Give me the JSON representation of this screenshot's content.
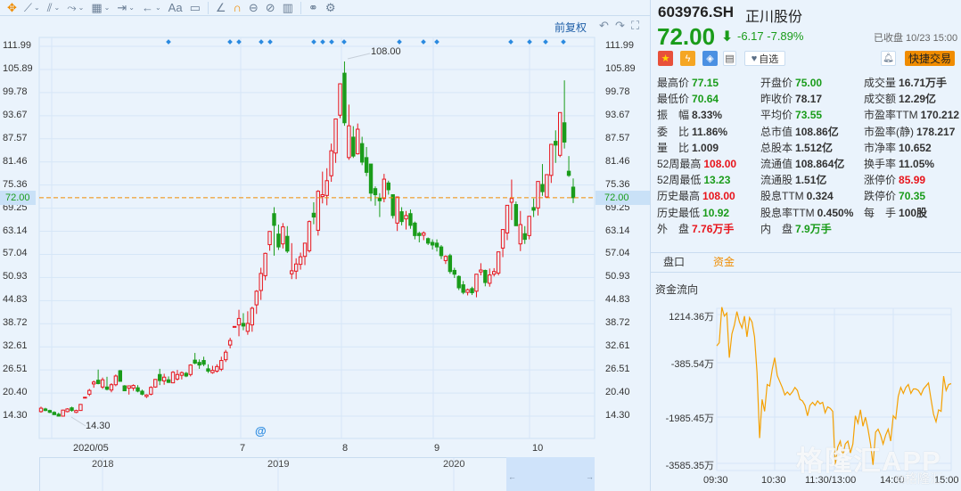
{
  "toolbar": {
    "items": [
      {
        "name": "move-tool-icon",
        "glyph": "✥",
        "chev": false,
        "accent": true
      },
      {
        "name": "line-tool-icon",
        "glyph": "⟋",
        "chev": true
      },
      {
        "name": "polyline-tool-icon",
        "glyph": "⫽",
        "chev": true
      },
      {
        "name": "wave-tool-icon",
        "glyph": "⤳",
        "chev": true
      },
      {
        "name": "shape-tool-icon",
        "glyph": "▦",
        "chev": true
      },
      {
        "name": "measure-tool-icon",
        "glyph": "⇥",
        "chev": true
      },
      {
        "name": "arrow-tool-icon",
        "glyph": "←",
        "chev": true
      },
      {
        "name": "text-tool-icon",
        "glyph": "Aa",
        "chev": false
      },
      {
        "name": "comment-tool-icon",
        "glyph": "▭",
        "chev": false
      },
      {
        "sep": true
      },
      {
        "name": "angle-tool-icon",
        "glyph": "∠",
        "chev": false
      },
      {
        "name": "magnet-icon",
        "glyph": "∩",
        "chev": false,
        "accent": true
      },
      {
        "name": "lock-drawing-icon",
        "glyph": "⊖",
        "chev": false
      },
      {
        "name": "hide-drawing-icon",
        "glyph": "⊘",
        "chev": false
      },
      {
        "name": "delete-icon",
        "glyph": "▥",
        "chev": false
      },
      {
        "sep": true
      },
      {
        "name": "compare-icon",
        "glyph": "⚭",
        "chev": false
      },
      {
        "name": "settings-icon",
        "glyph": "⚙",
        "chev": false
      }
    ]
  },
  "chart": {
    "adjust_label": "前复权",
    "undo": "↶",
    "redo": "↷",
    "fullscreen": "⛶",
    "current_price_tag": "72.00",
    "max_annotation": "108.00",
    "min_annotation": "14.30",
    "search_icon": "@",
    "x_labels": [
      "2020/05",
      "7",
      "8",
      "9",
      "10"
    ],
    "nav_years": [
      "2018",
      "2019",
      "2020"
    ],
    "nav_left": "←",
    "nav_right": "→"
  },
  "chart_data": {
    "type": "candlestick",
    "ylim": [
      14.3,
      111.99
    ],
    "y_ticks": [
      "111.99",
      "105.89",
      "99.78",
      "93.67",
      "87.57",
      "81.46",
      "75.36",
      "69.25",
      "63.14",
      "57.04",
      "50.93",
      "44.83",
      "38.72",
      "32.61",
      "26.51",
      "20.40",
      "14.30"
    ],
    "current_price": 72.0,
    "high_mark": 108.0,
    "low_mark": 14.3,
    "candles": [
      [
        15.5,
        16.8,
        15.2,
        16.4
      ],
      [
        16.2,
        16.5,
        15.6,
        15.8
      ],
      [
        15.8,
        16,
        15.1,
        15.3
      ],
      [
        15.3,
        15.6,
        14.6,
        14.7
      ],
      [
        14.8,
        15.2,
        14.2,
        14.3
      ],
      [
        14.3,
        16,
        14.2,
        15.9
      ],
      [
        15.5,
        16.4,
        15.3,
        16.2
      ],
      [
        16.5,
        16.8,
        15.5,
        15.8
      ],
      [
        15.3,
        16,
        15.1,
        15.8
      ],
      [
        15.8,
        17.5,
        15.7,
        17.4
      ],
      [
        19.3,
        19.3,
        19.3,
        19.3
      ],
      [
        20.1,
        21.5,
        19.6,
        21.1
      ],
      [
        22.8,
        23.7,
        21.8,
        23.3
      ],
      [
        23.8,
        26.6,
        22.7,
        22.9
      ],
      [
        22,
        24.5,
        21.5,
        23.9
      ],
      [
        22,
        24.7,
        21.1,
        21.4
      ],
      [
        21.2,
        23,
        20.6,
        22.6
      ],
      [
        22.6,
        25.3,
        22.2,
        24.9
      ],
      [
        26.3,
        26.5,
        23.4,
        23.5
      ],
      [
        22.3,
        22.5,
        21,
        21
      ],
      [
        21.7,
        22.3,
        20,
        22.3
      ],
      [
        21.7,
        22.7,
        21,
        22.4
      ],
      [
        21.8,
        22.5,
        20.6,
        20.9
      ],
      [
        20.9,
        21.3,
        19.8,
        20.1
      ],
      [
        19.5,
        20.1,
        19.1,
        19.9
      ],
      [
        20.1,
        22.2,
        19.8,
        21.9
      ],
      [
        22,
        24.1,
        21.8,
        24
      ],
      [
        25.3,
        26.8,
        22.5,
        23.7
      ],
      [
        23.6,
        25.5,
        22.6,
        24.6
      ],
      [
        23.9,
        24.8,
        23.1,
        23.2
      ],
      [
        23.1,
        26.2,
        23,
        25.9
      ],
      [
        24.1,
        26.5,
        23.7,
        25.3
      ],
      [
        25.1,
        26.1,
        24,
        25.8
      ],
      [
        25.6,
        26,
        24.6,
        24.9
      ],
      [
        25.3,
        28,
        24.8,
        27.8
      ],
      [
        29.1,
        31,
        28,
        28.3
      ],
      [
        28.5,
        29.3,
        26.8,
        27.8
      ],
      [
        29,
        30,
        27.5,
        28
      ],
      [
        26.8,
        28,
        25.7,
        26.2
      ],
      [
        25.8,
        27.6,
        25.5,
        26.4
      ],
      [
        26.2,
        28,
        25.8,
        27.4
      ],
      [
        26.7,
        30,
        26.2,
        29
      ],
      [
        29.2,
        31.8,
        28.6,
        31.2
      ],
      [
        33.1,
        35,
        32.2,
        34.3
      ],
      [
        38,
        38,
        38,
        38
      ],
      [
        38.4,
        42.4,
        35.4,
        40.1
      ],
      [
        38.8,
        41.5,
        37,
        38.1
      ],
      [
        36.7,
        42,
        35.8,
        38.8
      ],
      [
        38.4,
        43.2,
        36.6,
        42.8
      ],
      [
        43.7,
        47.6,
        41.3,
        47.3
      ],
      [
        47.5,
        53.5,
        45,
        52
      ],
      [
        51.4,
        57.5,
        50.2,
        57.3
      ],
      [
        59.6,
        63.1,
        58,
        63.1
      ],
      [
        67.8,
        69.5,
        56.7,
        64.7
      ],
      [
        62.4,
        64.9,
        58.2,
        59
      ],
      [
        59.8,
        65.3,
        58.6,
        64.3
      ],
      [
        61.8,
        64.5,
        57.4,
        57.9
      ],
      [
        51.9,
        60,
        50.5,
        52.7
      ],
      [
        52.6,
        56,
        50.5,
        54.5
      ],
      [
        54.4,
        57.5,
        53,
        56.4
      ],
      [
        56.5,
        60,
        54.2,
        60
      ],
      [
        58,
        66,
        57.5,
        65.7
      ],
      [
        67.9,
        70.8,
        65,
        66.9
      ],
      [
        63.4,
        74,
        62,
        73.7
      ],
      [
        72.3,
        78.9,
        70.5,
        72.8
      ],
      [
        72.6,
        79.8,
        70,
        76.5
      ],
      [
        77.8,
        86.3,
        76.2,
        84.4
      ],
      [
        83.8,
        92.8,
        81.2,
        92.8
      ],
      [
        93.8,
        102.1,
        93,
        102.1
      ],
      [
        104.9,
        108,
        91,
        91.8
      ],
      [
        82.6,
        96.6,
        82,
        91
      ],
      [
        88,
        90.9,
        82.5,
        83
      ],
      [
        83.6,
        91.6,
        83.4,
        90.1
      ],
      [
        86.3,
        88.1,
        80.6,
        81.4
      ],
      [
        82.6,
        85.4,
        77.7,
        78.7
      ],
      [
        80.9,
        80.9,
        71.1,
        73.2
      ],
      [
        74.4,
        75,
        69.9,
        72.8
      ],
      [
        71.9,
        73.2,
        66.9,
        71.2
      ],
      [
        71.8,
        78.3,
        70.8,
        76.9
      ],
      [
        75.9,
        76.5,
        72.8,
        74.1
      ],
      [
        72.8,
        72.8,
        66.5,
        67.3
      ],
      [
        65.3,
        72.2,
        63.2,
        72.2
      ],
      [
        68.3,
        69.5,
        64.7,
        65.7
      ],
      [
        66.4,
        68.5,
        63.6,
        67.3
      ],
      [
        67.8,
        68.9,
        63.8,
        64.7
      ],
      [
        65.3,
        65.7,
        61,
        62
      ],
      [
        62.6,
        63,
        60.2,
        62
      ],
      [
        62.1,
        63.1,
        60.8,
        62.7
      ],
      [
        61.2,
        61.5,
        59.5,
        60
      ],
      [
        60.2,
        61,
        58.3,
        59.5
      ],
      [
        60,
        61,
        57.8,
        59
      ],
      [
        59,
        59.5,
        55.8,
        56.7
      ],
      [
        55.4,
        56.8,
        54.5,
        56.5
      ],
      [
        56.7,
        57.2,
        51.9,
        52.5
      ],
      [
        52.8,
        53.5,
        50.8,
        51.8
      ],
      [
        51.2,
        51.5,
        47.6,
        48.2
      ],
      [
        49,
        50,
        46.5,
        47
      ],
      [
        47,
        48,
        46.2,
        47.7
      ],
      [
        48,
        48.5,
        46.3,
        46.9
      ],
      [
        47.3,
        51.8,
        45.7,
        51.8
      ],
      [
        52.4,
        54.7,
        51.5,
        52.9
      ],
      [
        52.8,
        53,
        48.6,
        49.6
      ],
      [
        49.4,
        53.3,
        48.5,
        51.6
      ],
      [
        51.8,
        53.4,
        51.2,
        52.5
      ],
      [
        52.1,
        57.7,
        51.5,
        57.7
      ],
      [
        58.7,
        63.6,
        56.3,
        63.6
      ],
      [
        62.7,
        70,
        60.8,
        70
      ],
      [
        70.8,
        76.8,
        66.1,
        71.8
      ],
      [
        70.2,
        71,
        64.6,
        64.6
      ],
      [
        59.8,
        68.5,
        57.9,
        64.9
      ],
      [
        62.5,
        64.5,
        59.8,
        61
      ],
      [
        62,
        67.1,
        61,
        67.1
      ],
      [
        69.4,
        71.8,
        66.9,
        68.7
      ],
      [
        69.3,
        76.3,
        67.3,
        76.3
      ],
      [
        75.5,
        80.9,
        72.5,
        73.6
      ],
      [
        72.2,
        78.1,
        72,
        78.1
      ],
      [
        77.9,
        86.1,
        75.9,
        86.1
      ],
      [
        86.9,
        89.8,
        81.2,
        85.9
      ],
      [
        83.2,
        94.5,
        82.7,
        94.5
      ],
      [
        91.8,
        103,
        85,
        86.7
      ],
      [
        79,
        83,
        77.5,
        77.9
      ],
      [
        74.8,
        77.1,
        70.6,
        72
      ]
    ]
  },
  "quote": {
    "code": "603976.SH",
    "name": "正川股份",
    "price": "72.00",
    "arrow": "⬇",
    "change": "-6.17",
    "change_pct": "-7.89%",
    "status": "已收盘 10/23 15:00",
    "watch_label": "自选",
    "trade_label": "快捷交易",
    "flag_icon": "★",
    "flash_icon": "ϟ",
    "tag_icon": "◈",
    "note_icon": "▤",
    "heart_icon": "♥",
    "bell_icon": "🔔︎"
  },
  "colors": {
    "up": "#e8141b",
    "down": "#1a9c1a",
    "accent": "#f08c00",
    "link": "#1f5fa8"
  },
  "stats": [
    {
      "label": "最高价",
      "value": "77.15",
      "c": "down"
    },
    {
      "label": "开盘价",
      "value": "75.00",
      "c": "down"
    },
    {
      "label": "成交量",
      "value": "16.71万手",
      "c": ""
    },
    {
      "label": "最低价",
      "value": "70.64",
      "c": "down"
    },
    {
      "label": "昨收价",
      "value": "78.17",
      "c": ""
    },
    {
      "label": "成交额",
      "value": "12.29亿",
      "c": ""
    },
    {
      "label": "振　幅",
      "value": "8.33%",
      "c": ""
    },
    {
      "label": "平均价",
      "value": "73.55",
      "c": "down"
    },
    {
      "label": "市盈率TTM",
      "value": "170.212",
      "c": ""
    },
    {
      "label": "委　比",
      "value": "11.86%",
      "c": ""
    },
    {
      "label": "总市值",
      "value": "108.86亿",
      "c": ""
    },
    {
      "label": "市盈率(静)",
      "value": "178.217",
      "c": ""
    },
    {
      "label": "量　比",
      "value": "1.009",
      "c": ""
    },
    {
      "label": "总股本",
      "value": "1.512亿",
      "c": ""
    },
    {
      "label": "市净率",
      "value": "10.652",
      "c": ""
    },
    {
      "label": "52周最高",
      "value": "108.00",
      "c": "up"
    },
    {
      "label": "流通值",
      "value": "108.864亿",
      "c": ""
    },
    {
      "label": "换手率",
      "value": "11.05%",
      "c": ""
    },
    {
      "label": "52周最低",
      "value": "13.23",
      "c": "down"
    },
    {
      "label": "流通股",
      "value": "1.51亿",
      "c": ""
    },
    {
      "label": "涨停价",
      "value": "85.99",
      "c": "up"
    },
    {
      "label": "历史最高",
      "value": "108.00",
      "c": "up"
    },
    {
      "label": "股息TTM",
      "value": "0.324",
      "c": ""
    },
    {
      "label": "跌停价",
      "value": "70.35",
      "c": "down"
    },
    {
      "label": "历史最低",
      "value": "10.92",
      "c": "down"
    },
    {
      "label": "股息率TTM",
      "value": "0.450%",
      "c": ""
    },
    {
      "label": "每　手",
      "value": "100股",
      "c": ""
    },
    {
      "label": "外　盘",
      "value": "7.76万手",
      "c": "up"
    },
    {
      "label": "内　盘",
      "value": "7.9万手",
      "c": "down"
    }
  ],
  "tabs": [
    {
      "label": "盘口",
      "active": false
    },
    {
      "label": "资金",
      "active": true
    }
  ],
  "money_flow": {
    "title": "资金流向",
    "y_labels": [
      "1214.36万",
      "-385.54万",
      "-1985.45万",
      "-3585.35万"
    ],
    "ylim": [
      -3585.35,
      1214.36
    ],
    "x_labels": [
      "09:30",
      "10:30",
      "11:30/13:00",
      "14:00",
      "15:00"
    ],
    "values": [
      206,
      302,
      1454,
      1166,
      1262,
      -178,
      590,
      878,
      1310,
      974,
      782,
      1166,
      494,
      1118,
      974,
      494,
      -658,
      -2770,
      -1522,
      -1906,
      -1042,
      -1090,
      -562,
      -178,
      -754,
      -946,
      -1138,
      -1378,
      -1282,
      -1378,
      -1282,
      -1138,
      -1234,
      -1522,
      -1570,
      -1714,
      -2050,
      -1714,
      -1618,
      -1714,
      -1570,
      -1666,
      -1618,
      -1954,
      -1762,
      -1810,
      -1906,
      -3634,
      -3058,
      -2866,
      -3346,
      -2962,
      -2866,
      -3250,
      -2962,
      -2050,
      -2290,
      -1858,
      -2386,
      -2098,
      -2482,
      -2962,
      -3634,
      -2578,
      -2482,
      -2674,
      -2962,
      -2674,
      -2482,
      -2866,
      -2050,
      -2146,
      -1426,
      -1138,
      -1330,
      -1138,
      -1042,
      -1330,
      -1186,
      -1186,
      -1234,
      -1378,
      -1186,
      -1090,
      -994,
      -1522,
      -2002,
      -2242,
      -1858,
      -1906,
      -773,
      -1234,
      -1042,
      -1013
    ]
  },
  "watermark": "格隆汇APP",
  "watermark_small": "⧉格隆汇"
}
